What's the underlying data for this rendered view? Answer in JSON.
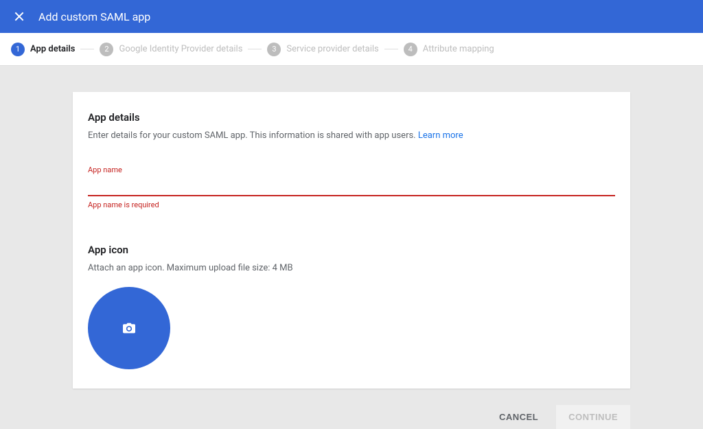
{
  "header": {
    "title": "Add custom SAML app"
  },
  "stepper": {
    "steps": [
      {
        "num": "1",
        "label": "App details",
        "active": true
      },
      {
        "num": "2",
        "label": "Google Identity Provider details",
        "active": false
      },
      {
        "num": "3",
        "label": "Service provider details",
        "active": false
      },
      {
        "num": "4",
        "label": "Attribute mapping",
        "active": false
      }
    ]
  },
  "card": {
    "section1_title": "App details",
    "section1_desc": "Enter details for your custom SAML app. This information is shared with app users. ",
    "learn_more": "Learn more",
    "app_name_label": "App name",
    "app_name_value": "",
    "app_name_error": "App name is required",
    "section2_title": "App icon",
    "section2_desc": "Attach an app icon. Maximum upload file size: 4 MB"
  },
  "actions": {
    "cancel": "Cancel",
    "continue": "Continue"
  }
}
